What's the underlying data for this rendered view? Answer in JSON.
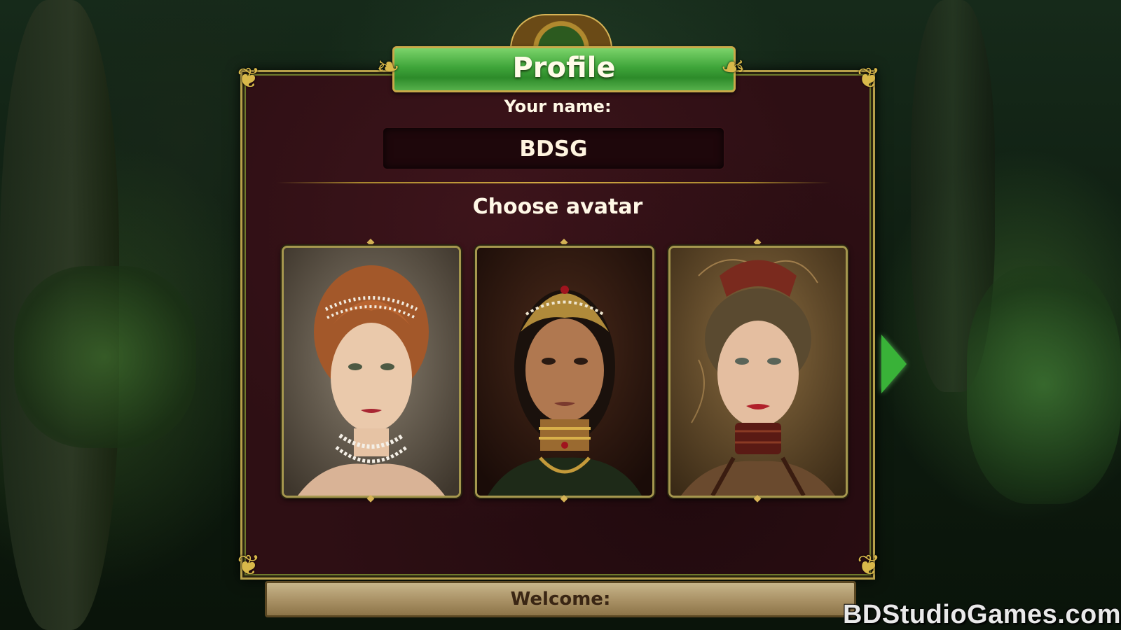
{
  "profile_dialog": {
    "title": "Profile",
    "name_label": "Your name:",
    "name_value": "BDSG",
    "avatar_heading": "Choose avatar",
    "avatars": [
      {
        "description_icon": "avatar-pearl-lady-icon",
        "palette": [
          "#6b5f52",
          "#b46a38",
          "#e8c6a6"
        ]
      },
      {
        "description_icon": "avatar-golden-crown-lady-icon",
        "palette": [
          "#3a1f14",
          "#b08a3a",
          "#9a6a48"
        ]
      },
      {
        "description_icon": "avatar-steampunk-lady-icon",
        "palette": [
          "#5a4328",
          "#7a2a1e",
          "#e4bea0"
        ]
      }
    ],
    "next_icon": "next-arrow-icon",
    "welcome_text": "Welcome:"
  },
  "watermark": "BDStudioGames.com",
  "colors": {
    "panel": "#2e0f14",
    "border_gold": "#b7a04a",
    "title_green": "#3fa53a",
    "arrow_green": "#39b238",
    "welcome_bar": "#a89064"
  }
}
